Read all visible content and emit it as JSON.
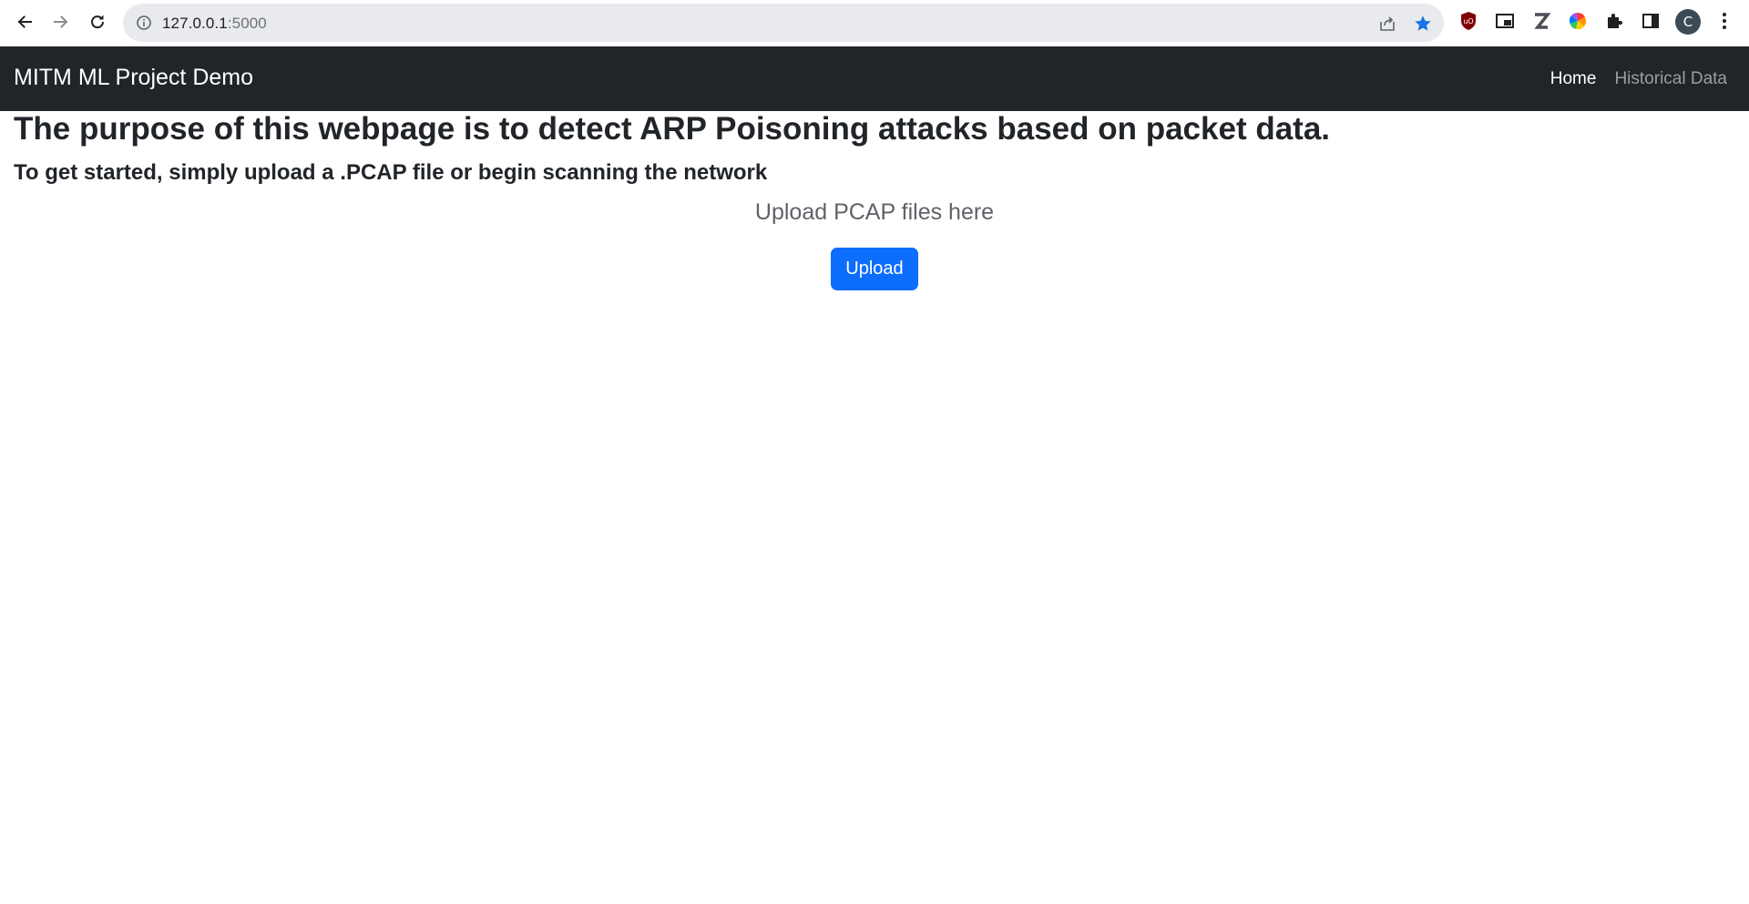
{
  "browser": {
    "url_host": "127.0.0.1",
    "url_port": ":5000",
    "avatar_initial": "C",
    "accent_color": "#1a73e8"
  },
  "navbar": {
    "brand": "MITM ML Project Demo",
    "links": [
      {
        "label": "Home",
        "active": true
      },
      {
        "label": "Historical Data",
        "active": false
      }
    ],
    "background": "#212529"
  },
  "main": {
    "headline": "The purpose of this webpage is to detect ARP Poisoning attacks based on packet data.",
    "subheadline": "To get started, simply upload a .PCAP file or begin scanning the network",
    "upload_label": "Upload PCAP files here",
    "upload_button": "Upload",
    "button_color": "#0d6efd"
  },
  "icons": {
    "back": "arrow-left-icon",
    "forward": "arrow-right-icon",
    "reload": "reload-icon",
    "site_info": "info-icon",
    "share": "share-icon",
    "bookmark": "star-icon",
    "extensions": [
      "ublock-icon",
      "picture-in-picture-icon",
      "z-extension-icon",
      "color-wheel-icon",
      "puzzle-icon",
      "side-panel-icon"
    ],
    "menu": "kebab-menu-icon"
  }
}
